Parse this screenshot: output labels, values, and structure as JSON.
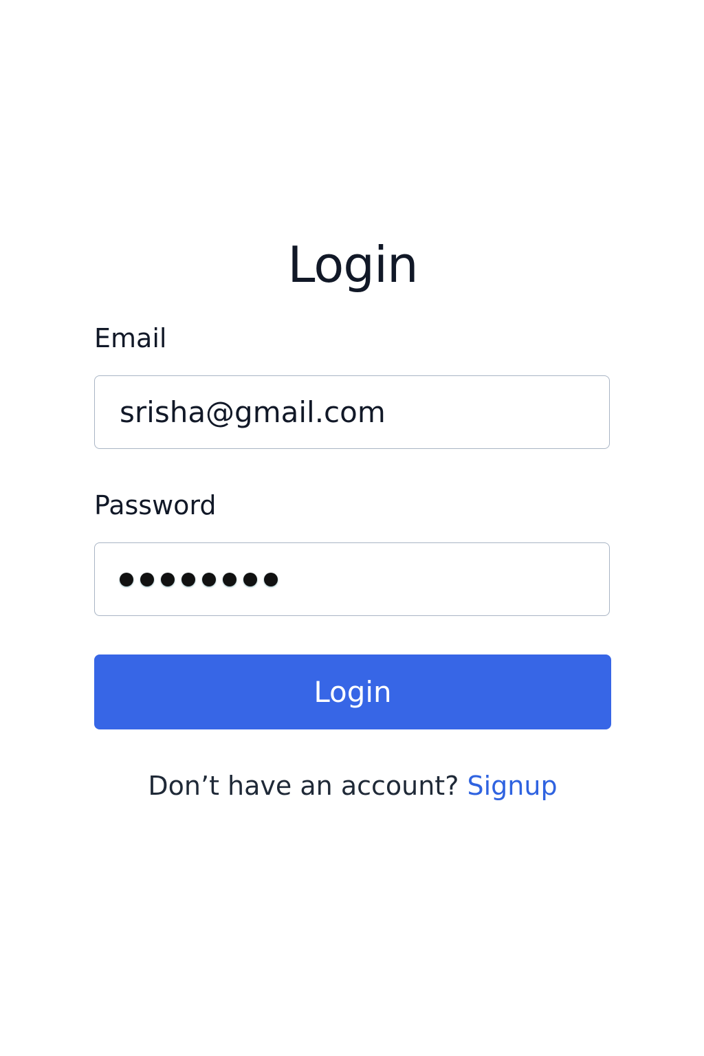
{
  "page": {
    "title": "Login"
  },
  "form": {
    "email_label": "Email",
    "email_value": "srisha@gmail.com",
    "password_label": "Password",
    "password_masked_count": 8,
    "submit_label": "Login"
  },
  "signup": {
    "prompt": "Don’t have an account?",
    "link_label": "Signup"
  },
  "colors": {
    "primary": "#3766e6",
    "link": "#2f63e0",
    "text": "#111827",
    "input_border": "#a8b4c4"
  }
}
